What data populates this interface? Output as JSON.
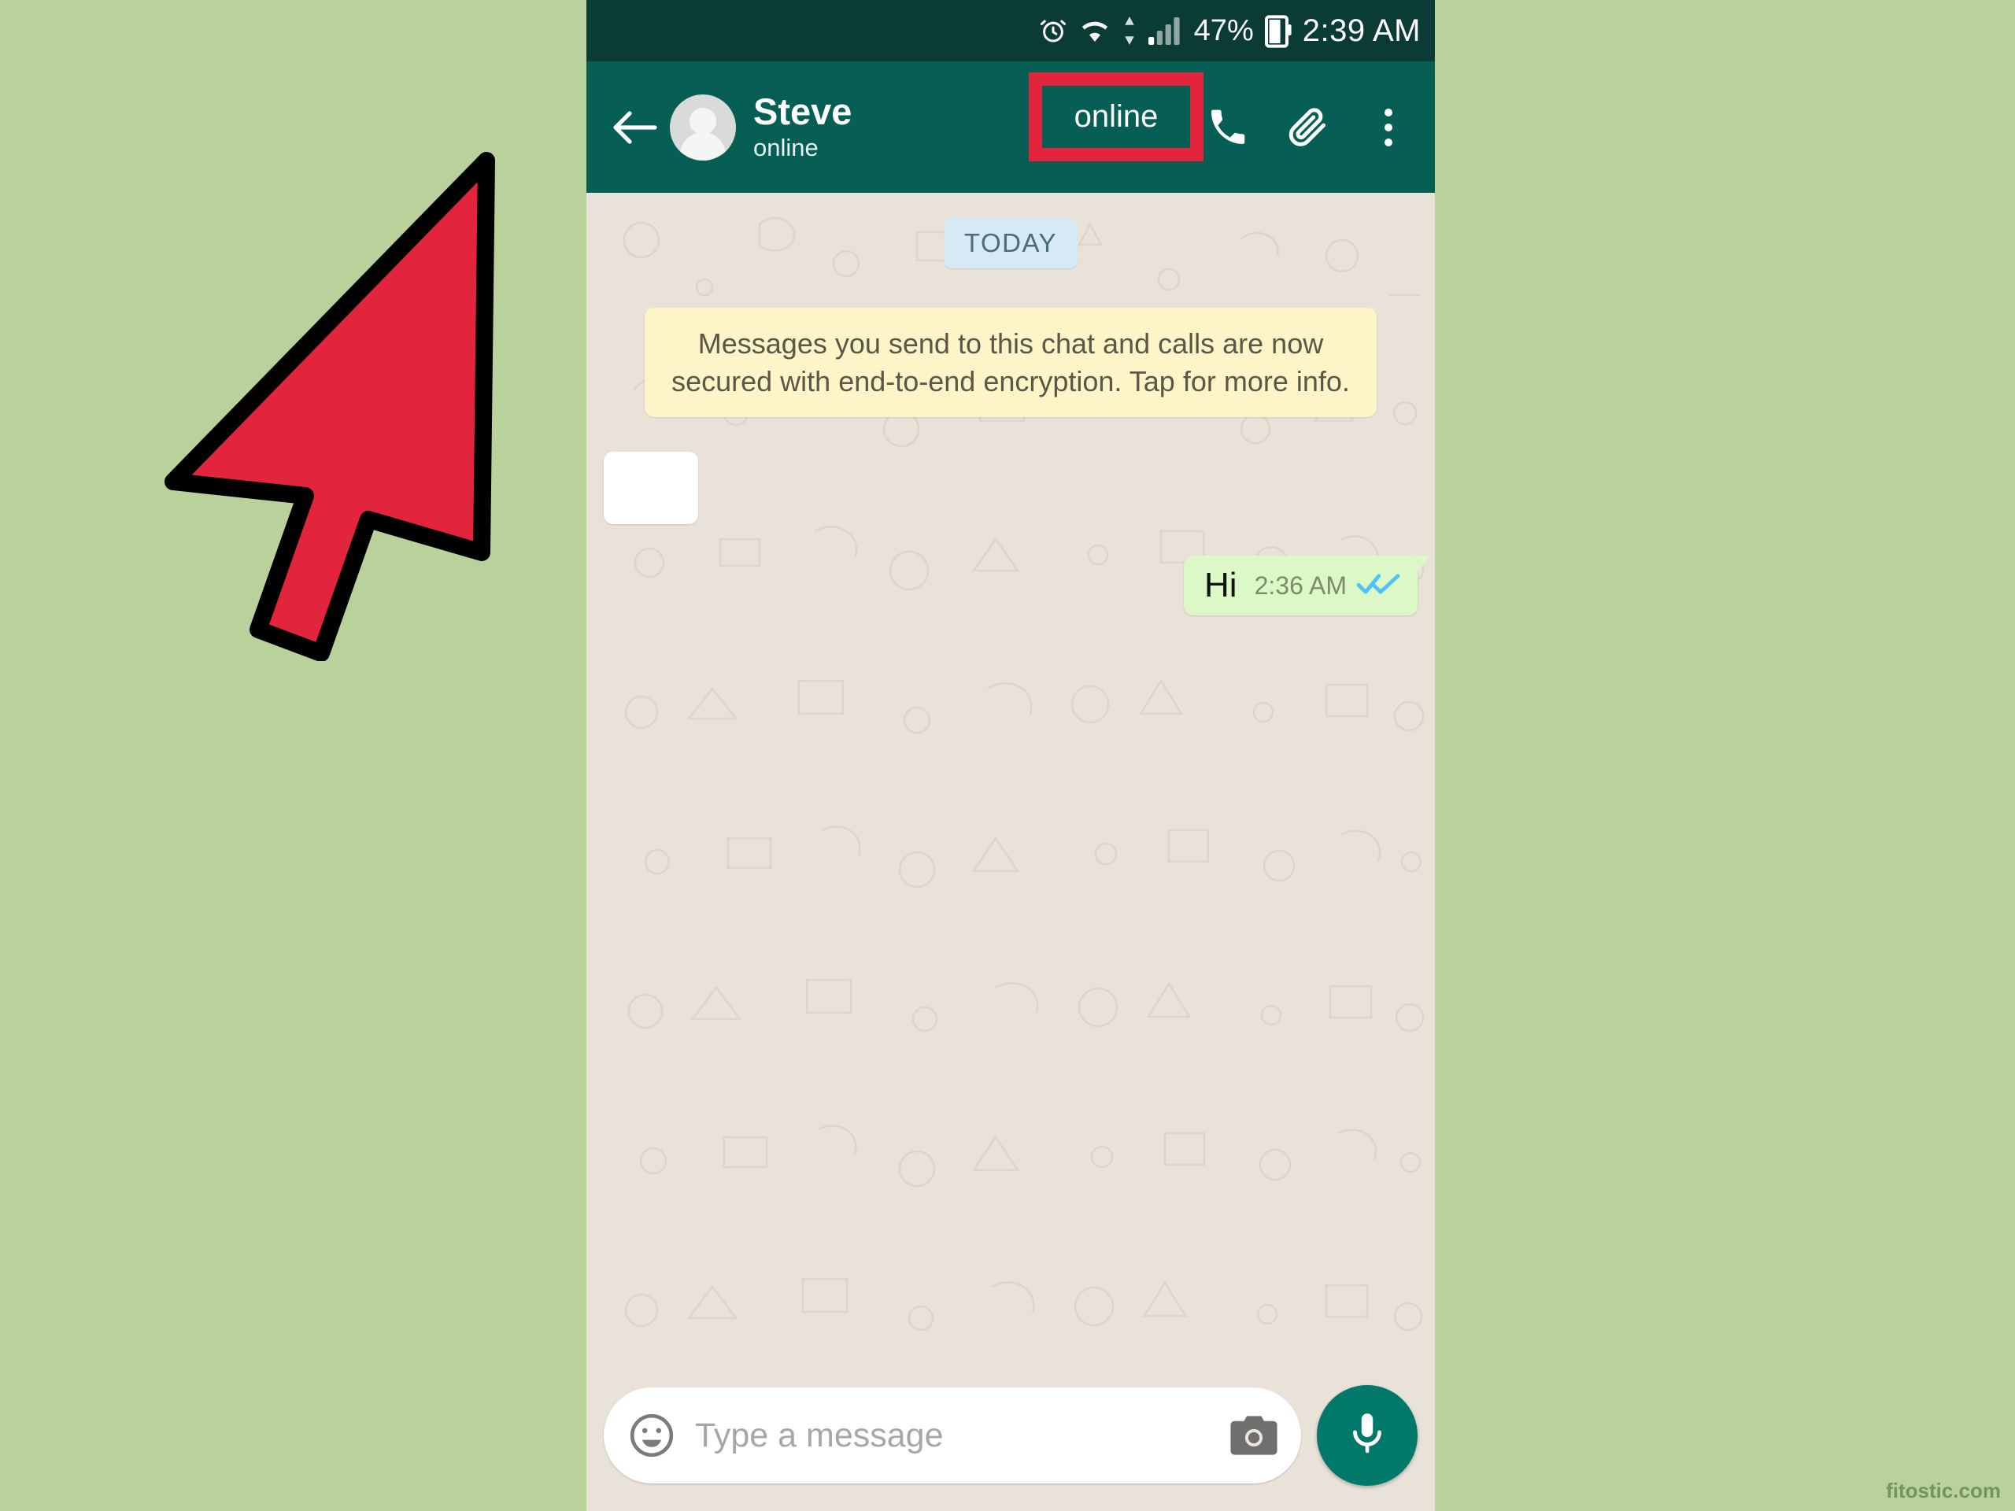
{
  "page": {
    "background_color": "#b9d19a",
    "watermark": "fitostic.com"
  },
  "status_bar": {
    "background_color": "#0a3b34",
    "alarm_icon": "alarm-clock-icon",
    "wifi_icon": "wifi-icon",
    "data_arrows_icon": "data-transfer-icon",
    "signal_icon": "cellular-signal-icon",
    "battery_percent": "47%",
    "battery_icon": "battery-icon",
    "time": "2:39 AM"
  },
  "app_bar": {
    "background_color": "#075e54",
    "back_icon": "back-arrow-icon",
    "avatar_icon": "contact-avatar",
    "contact_name": "Steve",
    "presence": "online",
    "call_icon": "phone-call-icon",
    "attach_icon": "paperclip-attach-icon",
    "menu_icon": "overflow-menu-icon"
  },
  "chat": {
    "background_color": "#e9e2d9",
    "day_divider": "TODAY",
    "encryption_notice": "Messages you send to this chat and calls are now secured with end-to-end encryption. Tap for more info.",
    "messages": [
      {
        "direction": "inbound",
        "text": "",
        "time": "",
        "note": "partially occluded white bubble"
      },
      {
        "direction": "outbound",
        "text": "Hi",
        "time": "2:36 AM",
        "receipt": "read-double-check-icon",
        "receipt_color": "#4fc3f7",
        "bubble_color": "#dcf8c6"
      }
    ]
  },
  "composer": {
    "emoji_icon": "emoji-smiley-icon",
    "placeholder": "Type a message",
    "value": "",
    "camera_icon": "camera-icon",
    "mic_icon": "microphone-icon",
    "mic_button_color": "#00796b"
  },
  "annotations": {
    "highlight": {
      "label": "online",
      "border_color": "#e3243d"
    },
    "cursor": {
      "name": "red-cursor-arrow",
      "fill_color": "#e3243d",
      "stroke_color": "#000000"
    }
  }
}
